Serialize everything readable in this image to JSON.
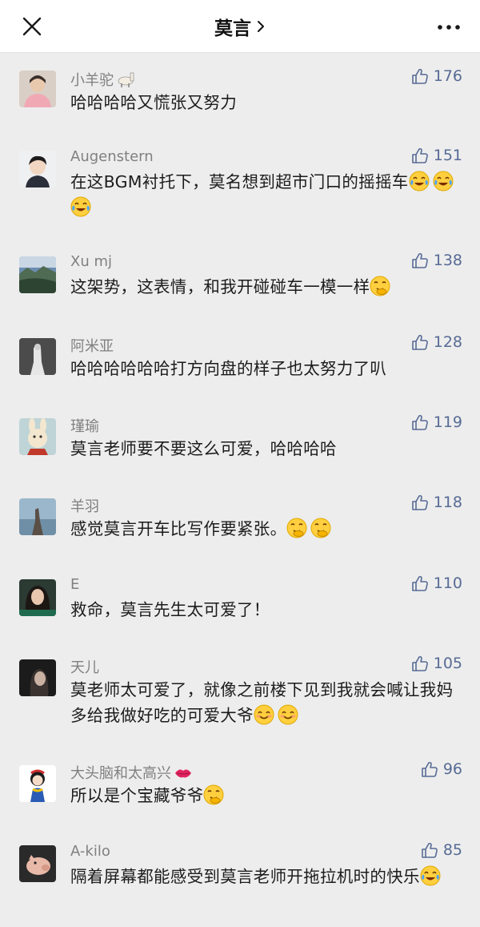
{
  "header": {
    "title": "莫言",
    "title_suffix_icon": "chevron-right-icon",
    "left_icon": "close-icon",
    "right_icon": "more-icon"
  },
  "colors": {
    "like": "#576b95",
    "name": "#808080",
    "background": "#ededed"
  },
  "comments": [
    {
      "name": "小羊驼",
      "name_icon": "alpaca-icon",
      "likes": "176",
      "text": "哈哈哈哈又慌张又努力",
      "emojis": []
    },
    {
      "name": "Augenstern",
      "likes": "151",
      "text": "在这BGM衬托下，莫名想到超市门口的摇摇车",
      "emojis": [
        "laugh-cry",
        "laugh-cry",
        "laugh-cry"
      ]
    },
    {
      "name": "Xu mj",
      "likes": "138",
      "text": "这架势，这表情，和我开碰碰车一模一样",
      "emojis": [
        "snicker"
      ]
    },
    {
      "name": "阿米亚",
      "likes": "128",
      "text": "哈哈哈哈哈哈打方向盘的样子也太努力了叭",
      "emojis": []
    },
    {
      "name": "瑾瑜",
      "likes": "119",
      "text": "莫言老师要不要这么可爱，哈哈哈哈",
      "emojis": []
    },
    {
      "name": "羊羽",
      "likes": "118",
      "text": "感觉莫言开车比写作要紧张。",
      "emojis": [
        "snicker",
        "snicker"
      ]
    },
    {
      "name": "E",
      "likes": "110",
      "text": "救命，莫言先生太可爱了！",
      "emojis": []
    },
    {
      "name": "天儿",
      "likes": "105",
      "text": "莫老师太可爱了，就像之前楼下见到我就会喊让我妈多给我做好吃的可爱大爷",
      "emojis": [
        "smile",
        "smile"
      ]
    },
    {
      "name": "大头脑和太高兴",
      "name_icon": "lips-icon",
      "likes": "96",
      "text": "所以是个宝藏爷爷",
      "emojis": [
        "snicker"
      ]
    },
    {
      "name": "A-kilo",
      "likes": "85",
      "text": "隔着屏幕都能感受到莫言老师开拖拉机时的快乐",
      "emojis": [
        "laugh-cry"
      ]
    }
  ]
}
